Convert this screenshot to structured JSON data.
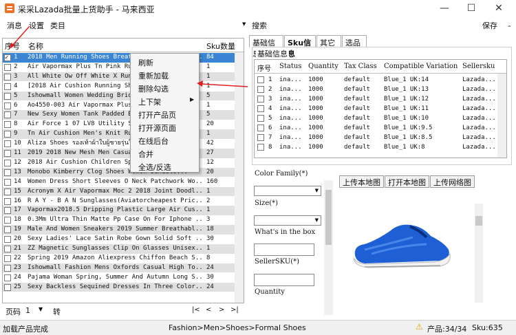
{
  "window": {
    "title": "采采Lazada批量上货助手 - 马来西亚"
  },
  "menu": {
    "items": [
      "消息",
      "设置",
      "类目"
    ],
    "search": "搜索",
    "save": "保存"
  },
  "product_grid": {
    "columns": [
      "序号",
      "名称",
      "Sku数量"
    ],
    "rows": [
      {
        "no": "1",
        "name": "2018 Men Running Shoes Breathable Outdoor Sp...",
        "sku": "84",
        "checked": true
      },
      {
        "no": "2",
        "name": "Air Vapormax Plus Tn Pink Running Shoes Men...",
        "sku": "1",
        "checked": false
      },
      {
        "no": "3",
        "name": "All White Ow Off White X Running Shoes Men...",
        "sku": "1",
        "checked": false
      },
      {
        "no": "4",
        "name": "[2018 Air Cushion Running Shoes Men Women...",
        "sku": "1",
        "checked": false
      },
      {
        "no": "5",
        "name": "Ishowmall Women Wedding Bridal Shoes...",
        "sku": "5",
        "checked": false
      },
      {
        "no": "6",
        "name": "Ao4550-003 Air Vapormax Plus Running Shoes...",
        "sku": "1",
        "checked": false
      },
      {
        "no": "7",
        "name": "New Sexy Women Tank Padded Bra Tops...",
        "sku": "5",
        "checked": false
      },
      {
        "no": "8",
        "name": "Air Force 1 07 LV8 Utility Sneakers...",
        "sku": "20",
        "checked": false
      },
      {
        "no": "9",
        "name": "Tn Air Cushion Men's Knit Running Shoes...",
        "sku": "1",
        "checked": false
      },
      {
        "no": "10",
        "name": "Aliza Shoes รองเท้าผ้าใบผู้ชายรุ่นใหม่...",
        "sku": "42",
        "checked": false
      },
      {
        "no": "11",
        "name": "2019 2018 New Mesh Men Casual Shoes...",
        "sku": "27",
        "checked": false
      },
      {
        "no": "12",
        "name": "2018 Air Cushion Children Sports Shoes...",
        "sku": "12",
        "checked": false
      },
      {
        "no": "13",
        "name": "Monobo Kimberry Clog Shoes Women Sandals...",
        "sku": "20",
        "checked": false
      },
      {
        "no": "14",
        "name": "Women Dress Short Sleeves O Neck Patchwork Wo...",
        "sku": "160",
        "checked": false
      },
      {
        "no": "15",
        "name": "Acronym X Air Vapormax Moc 2 2018 Joint Doodl...",
        "sku": "1",
        "checked": false
      },
      {
        "no": "16",
        "name": "R A Y - B A N Sunglasses(Aviatorcheapest Pric...",
        "sku": "2",
        "checked": false
      },
      {
        "no": "17",
        "name": "Vapormax2018.5 Dripping Plastic Large Air Cus...",
        "sku": "1",
        "checked": false
      },
      {
        "no": "18",
        "name": "0.3Mm Ultra Thin Matte Pp Case On For Iphone ...",
        "sku": "3",
        "checked": false
      },
      {
        "no": "19",
        "name": "Male And Women Sneakers 2019 Summer Breathabl...",
        "sku": "18",
        "checked": false
      },
      {
        "no": "20",
        "name": "Sexy Ladies' Lace Satin Robe Gown Solid Soft ...",
        "sku": "30",
        "checked": false
      },
      {
        "no": "21",
        "name": "ZZ Magnetic Sunglasses Clip On Glasses Unisex...",
        "sku": "1",
        "checked": false
      },
      {
        "no": "22",
        "name": "Spring 2019 Amazon Aliexpress Chiffon Beach S...",
        "sku": "8",
        "checked": false
      },
      {
        "no": "23",
        "name": "Ishowmall Fashion Mens Oxfords Casual High To...",
        "sku": "24",
        "checked": false
      },
      {
        "no": "24",
        "name": "Pajama Woman Spring, Summer And Autumn Long S...",
        "sku": "30",
        "checked": false
      },
      {
        "no": "25",
        "name": "Sexy Backless Sequined Dresses In Three Color...",
        "sku": "24",
        "checked": false
      }
    ]
  },
  "context_menu": {
    "items": [
      "刷新",
      "重新加载",
      "删除勾选",
      "上下架",
      "打开产品页",
      "打开源页面",
      "在线后台",
      "合并",
      "全选/反选"
    ]
  },
  "pager": {
    "label": "页码",
    "page": "1",
    "goto": "转"
  },
  "tabs": [
    "基础信息",
    "Sku信息",
    "其它",
    "选品"
  ],
  "sku_panel": {
    "group_title": "基础信息",
    "columns": [
      "序号",
      "Status",
      "Quantity",
      "Tax Class",
      "Compatible Variation",
      "Sellersku"
    ],
    "rows": [
      {
        "no": "1",
        "status": "ina...",
        "qty": "1000",
        "tax": "default",
        "var": "Blue_1 UK:14",
        "seller": "Lazada..."
      },
      {
        "no": "2",
        "status": "ina...",
        "qty": "1000",
        "tax": "default",
        "var": "Blue_1 UK:13",
        "seller": "Lazada..."
      },
      {
        "no": "3",
        "status": "ina...",
        "qty": "1000",
        "tax": "default",
        "var": "Blue_1 UK:12",
        "seller": "Lazada..."
      },
      {
        "no": "4",
        "status": "ina...",
        "qty": "1000",
        "tax": "default",
        "var": "Blue_1 UK:11",
        "seller": "Lazada..."
      },
      {
        "no": "5",
        "status": "ina...",
        "qty": "1000",
        "tax": "default",
        "var": "Blue_1 UK:10",
        "seller": "Lazada..."
      },
      {
        "no": "6",
        "status": "ina...",
        "qty": "1000",
        "tax": "default",
        "var": "Blue_1 UK:9.5",
        "seller": "Lazada..."
      },
      {
        "no": "7",
        "status": "ina...",
        "qty": "1000",
        "tax": "default",
        "var": "Blue_1 UK:8.5",
        "seller": "Lazada..."
      },
      {
        "no": "8",
        "status": "ina...",
        "qty": "1000",
        "tax": "default",
        "var": "Blue_1 UK:8",
        "seller": "Lazada..."
      }
    ]
  },
  "form": {
    "color_family": "Color Family(*)",
    "size": "Size(*)",
    "whats_in_box": "What's in the box",
    "seller_sku": "SellerSKU(*)",
    "quantity": "Quantity"
  },
  "image_buttons": [
    "上传本地图",
    "打开本地图",
    "上传网络图"
  ],
  "status": {
    "left": "加载产品完成",
    "category": "Fashion>Men>Shoes>Formal Shoes",
    "products": "产品:34/34",
    "sku": "Sku:635"
  },
  "colors": {
    "selection": "#3b86d4",
    "shoe_blue": "#1f5fd6",
    "logo": "#f37021"
  }
}
